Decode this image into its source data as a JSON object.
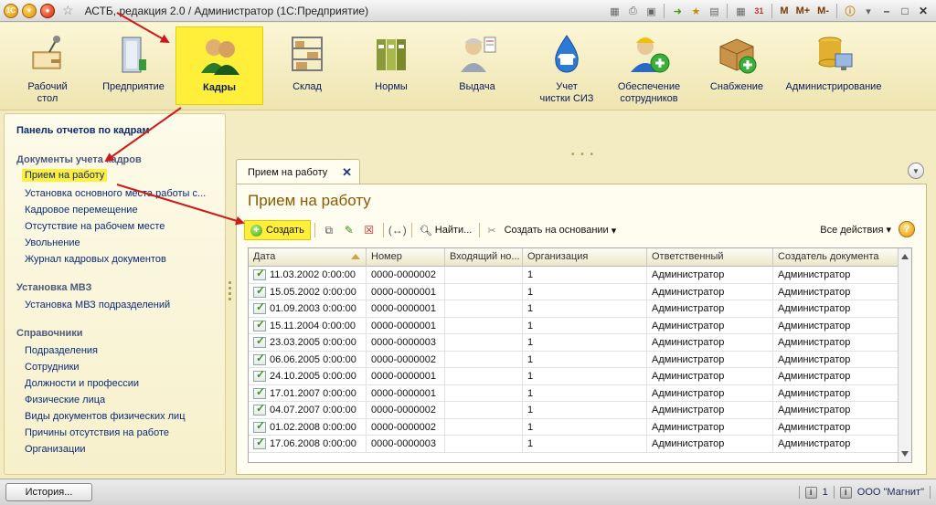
{
  "window": {
    "title": "АСТБ, редакция 2.0 / Администратор  (1С:Предприятие)",
    "m_buttons": [
      "M",
      "M+",
      "M-"
    ]
  },
  "sections": [
    {
      "label": "Рабочий\nстол",
      "icon": "desktop-icon"
    },
    {
      "label": "Предприятие",
      "icon": "enterprise-icon"
    },
    {
      "label": "Кадры",
      "icon": "staff-icon",
      "active": true
    },
    {
      "label": "Склад",
      "icon": "warehouse-icon"
    },
    {
      "label": "Нормы",
      "icon": "norms-icon"
    },
    {
      "label": "Выдача",
      "icon": "issue-icon"
    },
    {
      "label": "Учет\nчистки СИЗ",
      "icon": "cleaning-icon"
    },
    {
      "label": "Обеспечение\nсотрудников",
      "icon": "provision-icon"
    },
    {
      "label": "Снабжение",
      "icon": "supply-icon"
    },
    {
      "label": "Администрирование",
      "icon": "admin-icon"
    }
  ],
  "left_panel": {
    "title": "Панель отчетов по кадрам",
    "groups": [
      {
        "title": "Документы учета кадров",
        "items": [
          "Прием на работу",
          "Установка основного места работы с...",
          "Кадровое перемещение",
          "Отсутствие на рабочем месте",
          "Увольнение",
          "Журнал кадровых документов"
        ]
      },
      {
        "title": "Установка МВЗ",
        "items": [
          "Установка МВЗ подразделений"
        ]
      },
      {
        "title": "Справочники",
        "items": [
          "Подразделения",
          "Сотрудники",
          "Должности и профессии",
          "Физические лица",
          "Виды документов физических лиц",
          "Причины отсутствия на работе",
          "Организации"
        ]
      }
    ]
  },
  "tab": {
    "label": "Прием на работу"
  },
  "form": {
    "title": "Прием на работу",
    "toolbar": {
      "create": "Создать",
      "find": "Найти...",
      "create_based": "Создать на основании",
      "all_actions": "Все действия"
    },
    "columns": [
      "Дата",
      "Номер",
      "Входящий но...",
      "Организация",
      "Ответственный",
      "Создатель документа"
    ],
    "rows": [
      [
        "11.03.2002 0:00:00",
        "0000-0000002",
        "",
        "1",
        "Администратор",
        "Администратор"
      ],
      [
        "15.05.2002 0:00:00",
        "0000-0000001",
        "",
        "1",
        "Администратор",
        "Администратор"
      ],
      [
        "01.09.2003 0:00:00",
        "0000-0000001",
        "",
        "1",
        "Администратор",
        "Администратор"
      ],
      [
        "15.11.2004 0:00:00",
        "0000-0000001",
        "",
        "1",
        "Администратор",
        "Администратор"
      ],
      [
        "23.03.2005 0:00:00",
        "0000-0000003",
        "",
        "1",
        "Администратор",
        "Администратор"
      ],
      [
        "06.06.2005 0:00:00",
        "0000-0000002",
        "",
        "1",
        "Администратор",
        "Администратор"
      ],
      [
        "24.10.2005 0:00:00",
        "0000-0000001",
        "",
        "1",
        "Администратор",
        "Администратор"
      ],
      [
        "17.01.2007 0:00:00",
        "0000-0000001",
        "",
        "1",
        "Администратор",
        "Администратор"
      ],
      [
        "04.07.2007 0:00:00",
        "0000-0000002",
        "",
        "1",
        "Администратор",
        "Администратор"
      ],
      [
        "01.02.2008 0:00:00",
        "0000-0000002",
        "",
        "1",
        "Администратор",
        "Администратор"
      ],
      [
        "17.06.2008 0:00:00",
        "0000-0000003",
        "",
        "1",
        "Администратор",
        "Администратор"
      ]
    ]
  },
  "statusbar": {
    "history": "История...",
    "count": "1",
    "org": "ООО \"Магнит\""
  },
  "colors": {
    "highlight": "#ffef3a",
    "arrow": "#cc1a1a",
    "link": "#0a2a7a"
  }
}
